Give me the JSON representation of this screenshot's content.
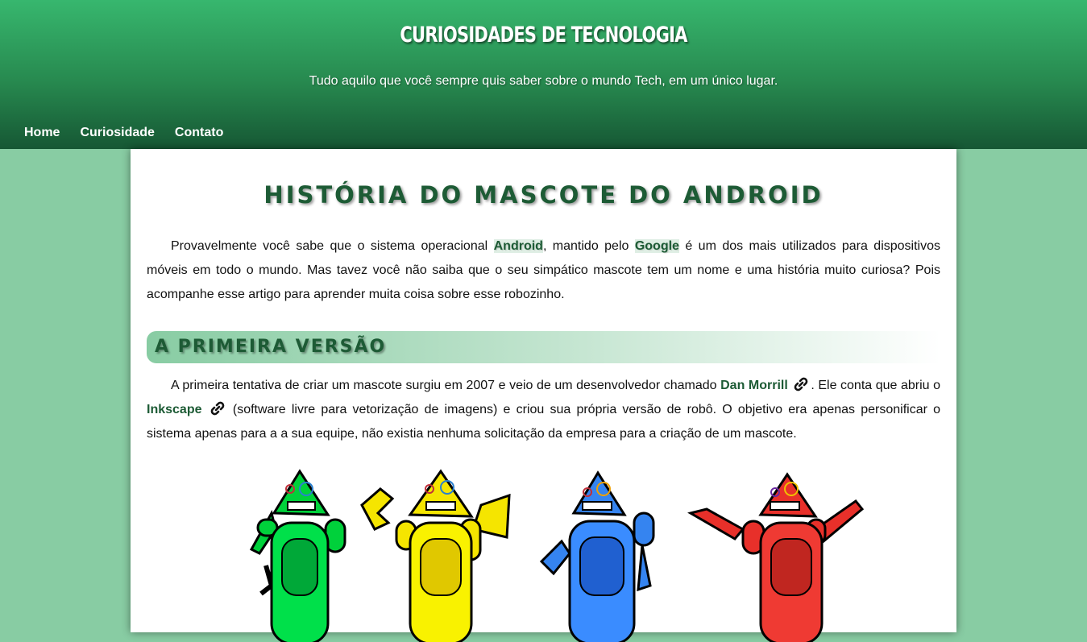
{
  "header": {
    "title": "Curiosidades de Tecnologia",
    "subtitle": "Tudo aquilo que você sempre quis saber sobre o mundo Tech, em um único lugar."
  },
  "nav": {
    "home": "Home",
    "curiosidade": "Curiosidade",
    "contato": "Contato"
  },
  "article": {
    "title": "História do mascote do Android",
    "intro": {
      "t1": "Provavelmente você sabe que o sistema operacional ",
      "android": "Android",
      "t2": ", mantido pelo ",
      "google": "Google",
      "t3": " é um dos mais utilizados para dispositivos móveis em todo o mundo. Mas tavez você não saiba que o seu simpático mascote tem um nome e uma história muito curiosa? Pois acompanhe esse artigo para aprender muita coisa sobre esse robozinho."
    },
    "section1": {
      "heading": "A primeira versão",
      "t1": "A primeira tentativa de criar um mascote surgiu em 2007 e veio de um desenvolvedor chamado ",
      "dan": "Dan Morrill",
      "t2": ". Ele conta que abriu o ",
      "inkscape": "Inkscape",
      "t3": " (software livre para vetorização de imagens) e criou sua própria versão de robô. O objetivo era apenas personificar o sistema apenas para a a sua equipe, não existia nenhuma solicitação da empresa para a criação de um mascote."
    }
  },
  "illustration": {
    "robot_colors": [
      "#00d13b",
      "#f5e500",
      "#3584f0",
      "#e8302a"
    ]
  },
  "colors": {
    "accent": "#1d5b35",
    "page_background": "#88cca3",
    "header_top": "#37b76e",
    "header_bottom": "#165734"
  }
}
